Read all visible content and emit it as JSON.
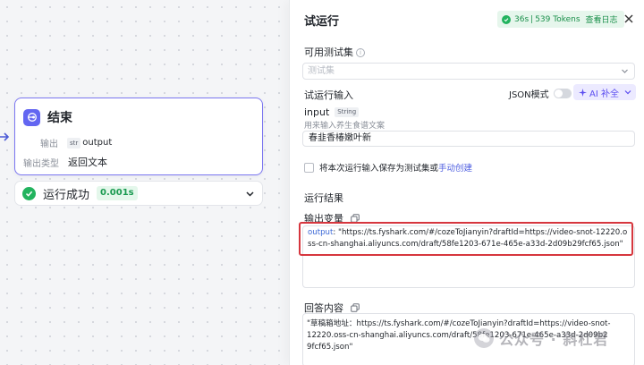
{
  "canvas": {
    "end_node": {
      "title": "结束",
      "output_label": "输出",
      "output_type": "str",
      "output_name": "output",
      "output_kind_label": "输出类型",
      "output_kind_value": "返回文本"
    },
    "status": {
      "text": "运行成功",
      "time": "0.001s"
    }
  },
  "panel": {
    "title": "试运行",
    "stats": {
      "duration": "36s",
      "separator": "|",
      "tokens": "539 Tokens",
      "log_link": "查看日志"
    },
    "testset": {
      "label": "可用测试集",
      "placeholder": "测试集"
    },
    "run_input": {
      "label": "试运行输入",
      "json_mode_label": "JSON模式",
      "json_mode_on": false,
      "ai_button": "AI 补全"
    },
    "field": {
      "name": "input",
      "type": "String",
      "description": "用来输入养生食谱文案",
      "value": "春韭香椿嫩叶新"
    },
    "save_option": {
      "text": "将本次运行输入保存为测试集或",
      "link": "手动创建"
    },
    "results": {
      "heading": "运行结果",
      "output_vars_label": "输出变量",
      "output_key": "output",
      "output_value": ": \"https://ts.fyshark.com/#/cozeToJianyin?draftId=https://video-snot-12220.oss-cn-shanghai.aliyuncs.com/draft/58fe1203-671e-465e-a33d-2d09b29fcf65.json\"",
      "answer_label": "回答内容",
      "answer_value": "\"草稿箱地址：https://ts.fyshark.com/#/cozeToJianyin?draftId=https://video-snot-12220.oss-cn-shanghai.aliyuncs.com/draft/58fe1203-671e-465e-a33d-2d09b29fcf65.json\""
    }
  },
  "watermark": {
    "text": "公众号 · 斜杠君"
  },
  "colors": {
    "accent": "#6366f1",
    "success": "#22b35e",
    "highlight": "#d6363e",
    "link": "#4f5fe0"
  }
}
